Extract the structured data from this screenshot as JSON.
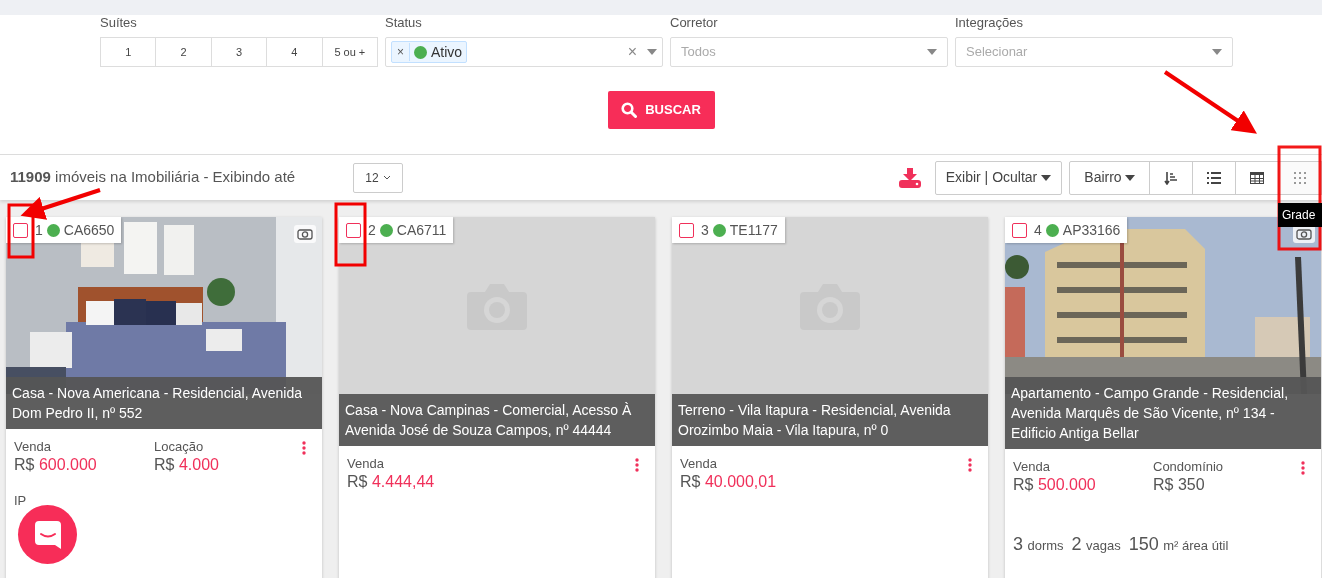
{
  "filters": {
    "suites": {
      "label": "Suítes",
      "options": [
        {
          "label": "1",
          "selected": false
        },
        {
          "label": "2",
          "selected": false
        },
        {
          "label": "3",
          "selected": false
        },
        {
          "label": "4",
          "selected": false
        },
        {
          "label": "5 ou +",
          "selected": false
        }
      ]
    },
    "status": {
      "label": "Status",
      "chips": [
        {
          "remove": "×",
          "label": "Ativo",
          "color": "#4caf50"
        }
      ],
      "clear": "×"
    },
    "corretor": {
      "label": "Corretor",
      "placeholder": "Todos"
    },
    "integracoes": {
      "label": "Integrações",
      "placeholder": "Selecionar"
    },
    "search_button": "BUSCAR"
  },
  "toolbar": {
    "summary": "**11909** imóveis na Imobiliária - Exibindo até",
    "page_size": "12",
    "columns_button": "Exibir | Ocultar",
    "sort_button": "Bairro",
    "views": [
      {
        "kind": "sort",
        "selected": false
      },
      {
        "kind": "list",
        "selected": false
      },
      {
        "kind": "table",
        "selected": false
      },
      {
        "kind": "grid",
        "selected": true
      }
    ],
    "tooltip": "Grade"
  },
  "cards": [
    {
      "index": "1",
      "code": "CA6650",
      "color": "#4caf50",
      "checked": false,
      "photo": {
        "kind": "picture"
      },
      "title": "Casa - Nova Americana - Residencial, Avenida Dom Pedro II, nº 552",
      "prices": [
        {
          "label": "Venda",
          "currency": "R$",
          "value": "600.000",
          "accent": true
        },
        {
          "label": "Locação",
          "currency": "R$",
          "value": "4.000",
          "accent": true
        }
      ],
      "extra_label": "IP"
    },
    {
      "index": "2",
      "code": "CA6711",
      "color": "#4caf50",
      "checked": false,
      "title": "Casa - Nova Campinas - Comercial, Acesso À Avenida José de Souza Campos, nº 44444",
      "prices": [
        {
          "label": "Venda",
          "currency": "R$",
          "value": "4.444,44",
          "accent": true
        }
      ]
    },
    {
      "index": "3",
      "code": "TE1177",
      "color": "#4caf50",
      "checked": false,
      "title": "Terreno - Vila Itapura - Residencial, Avenida Orozimbo Maia - Vila Itapura, nº 0",
      "prices": [
        {
          "label": "Venda",
          "currency": "R$",
          "value": "40.000,01",
          "accent": true
        }
      ]
    },
    {
      "index": "4",
      "code": "AP33166",
      "color": "#4caf50",
      "checked": false,
      "photo": {
        "kind": "picture"
      },
      "title": "Apartamento - Campo Grande - Residencial, Avenida Marquês de São Vicente, nº 134 - Edificio Antiga Bellar",
      "prices": [
        {
          "label": "Venda",
          "currency": "R$",
          "value": "500.000",
          "accent": true
        },
        {
          "label": "Condomínio",
          "currency": "R$",
          "value": "350",
          "accent": false
        }
      ],
      "features": [
        {
          "number": "3",
          "unit": "dorms"
        },
        {
          "number": "2",
          "unit": "vagas"
        },
        {
          "number": "150",
          "unit": "m² área útil"
        }
      ]
    }
  ]
}
